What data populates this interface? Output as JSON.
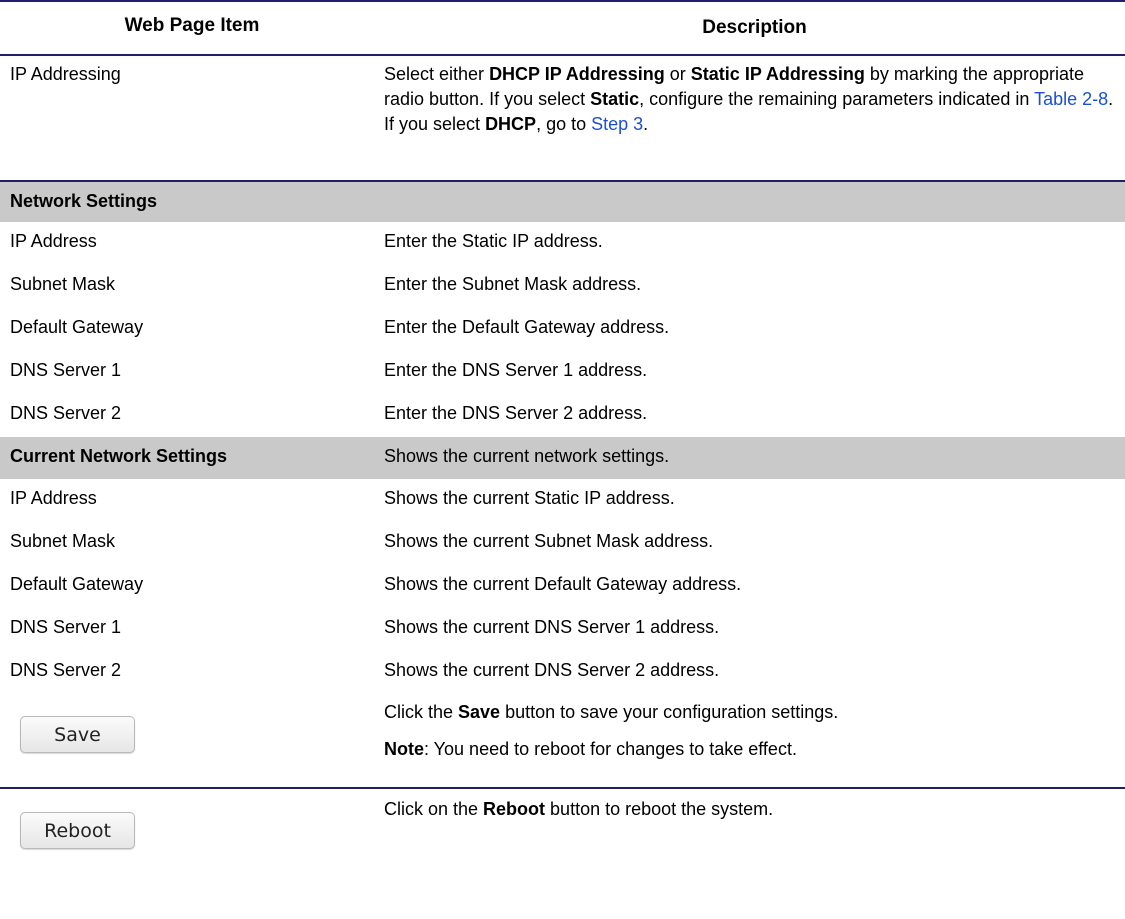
{
  "header": {
    "col1": "Web Page Item",
    "col2": "Description"
  },
  "ip_addressing": {
    "item": "IP Addressing",
    "desc": {
      "t1": "Select either ",
      "b1": "DHCP IP Addressing",
      "t2": " or ",
      "b2": "Static IP Addressing",
      "t3": " by marking the appropriate radio button. If you select ",
      "b3": "Static",
      "t4": ", configure the remaining parameters indicated in ",
      "link1": "Table 2-8",
      "t5": ". If you select ",
      "b4": "DHCP",
      "t6": ", go to ",
      "link2": "Step 3",
      "t7": "."
    }
  },
  "network_settings": {
    "heading": "Network Settings",
    "rows": [
      {
        "item": "IP Address",
        "desc": "Enter the Static IP address."
      },
      {
        "item": "Subnet Mask",
        "desc": "Enter the Subnet Mask address."
      },
      {
        "item": "Default Gateway",
        "desc": "Enter the Default Gateway address."
      },
      {
        "item": "DNS Server 1",
        "desc": "Enter the DNS Server 1 address."
      },
      {
        "item": "DNS Server 2",
        "desc": "Enter the DNS Server 2 address."
      }
    ]
  },
  "current_network_settings": {
    "heading": "Current Network Settings",
    "heading_desc": "Shows the current network settings.",
    "rows": [
      {
        "item": "IP Address",
        "desc": "Shows the current Static IP address."
      },
      {
        "item": "Subnet Mask",
        "desc": "Shows the current Subnet Mask address."
      },
      {
        "item": "Default Gateway",
        "desc": "Shows the current Default Gateway address."
      },
      {
        "item": "DNS Server 1",
        "desc": "Shows the current DNS Server 1 address."
      },
      {
        "item": "DNS Server 2",
        "desc": "Shows the current DNS Server 2 address."
      }
    ]
  },
  "save": {
    "button_label": "Save",
    "desc_t1": "Click the ",
    "desc_b1": "Save",
    "desc_t2": " button to save your configuration settings.",
    "note_label": "Note",
    "note_text": ": You need to reboot for changes to take effect."
  },
  "reboot": {
    "button_label": "Reboot",
    "desc_t1": "Click on the ",
    "desc_b1": "Reboot",
    "desc_t2": " button to reboot the system."
  },
  "colors": {
    "rule": "#1f1f6b",
    "shade": "#c9c9c9",
    "link": "#1a4fd6"
  }
}
